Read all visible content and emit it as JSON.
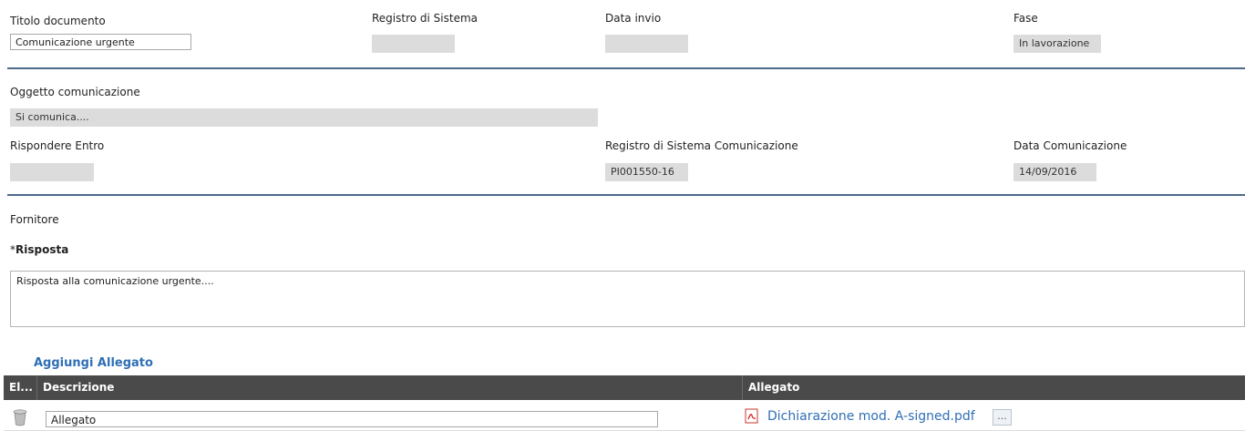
{
  "header": {
    "titolo_label": "Titolo documento",
    "titolo_value": "Comunicazione urgente",
    "registro_label": "Registro di Sistema",
    "registro_value": "",
    "data_invio_label": "Data invio",
    "data_invio_value": "",
    "fase_label": "Fase",
    "fase_value": "In lavorazione"
  },
  "comunicazione": {
    "oggetto_label": "Oggetto comunicazione",
    "oggetto_value": "Si comunica....",
    "rispondere_label": "Rispondere Entro",
    "rispondere_value": "",
    "registro_com_label": "Registro di Sistema Comunicazione",
    "registro_com_value": "PI001550-16",
    "data_com_label": "Data Comunicazione",
    "data_com_value": "14/09/2016"
  },
  "risposta": {
    "fornitore_label": "Fornitore",
    "required_mark": "*",
    "risposta_label": "Risposta",
    "risposta_value": "Risposta alla comunicazione urgente...."
  },
  "allegati": {
    "add_label": "Aggiungi Allegato",
    "columns": [
      "El...",
      "Descrizione",
      "Allegato"
    ],
    "rows": [
      {
        "descrizione": "Allegato",
        "file": "Dichiarazione mod. A-signed.pdf",
        "browse": "..."
      }
    ]
  }
}
